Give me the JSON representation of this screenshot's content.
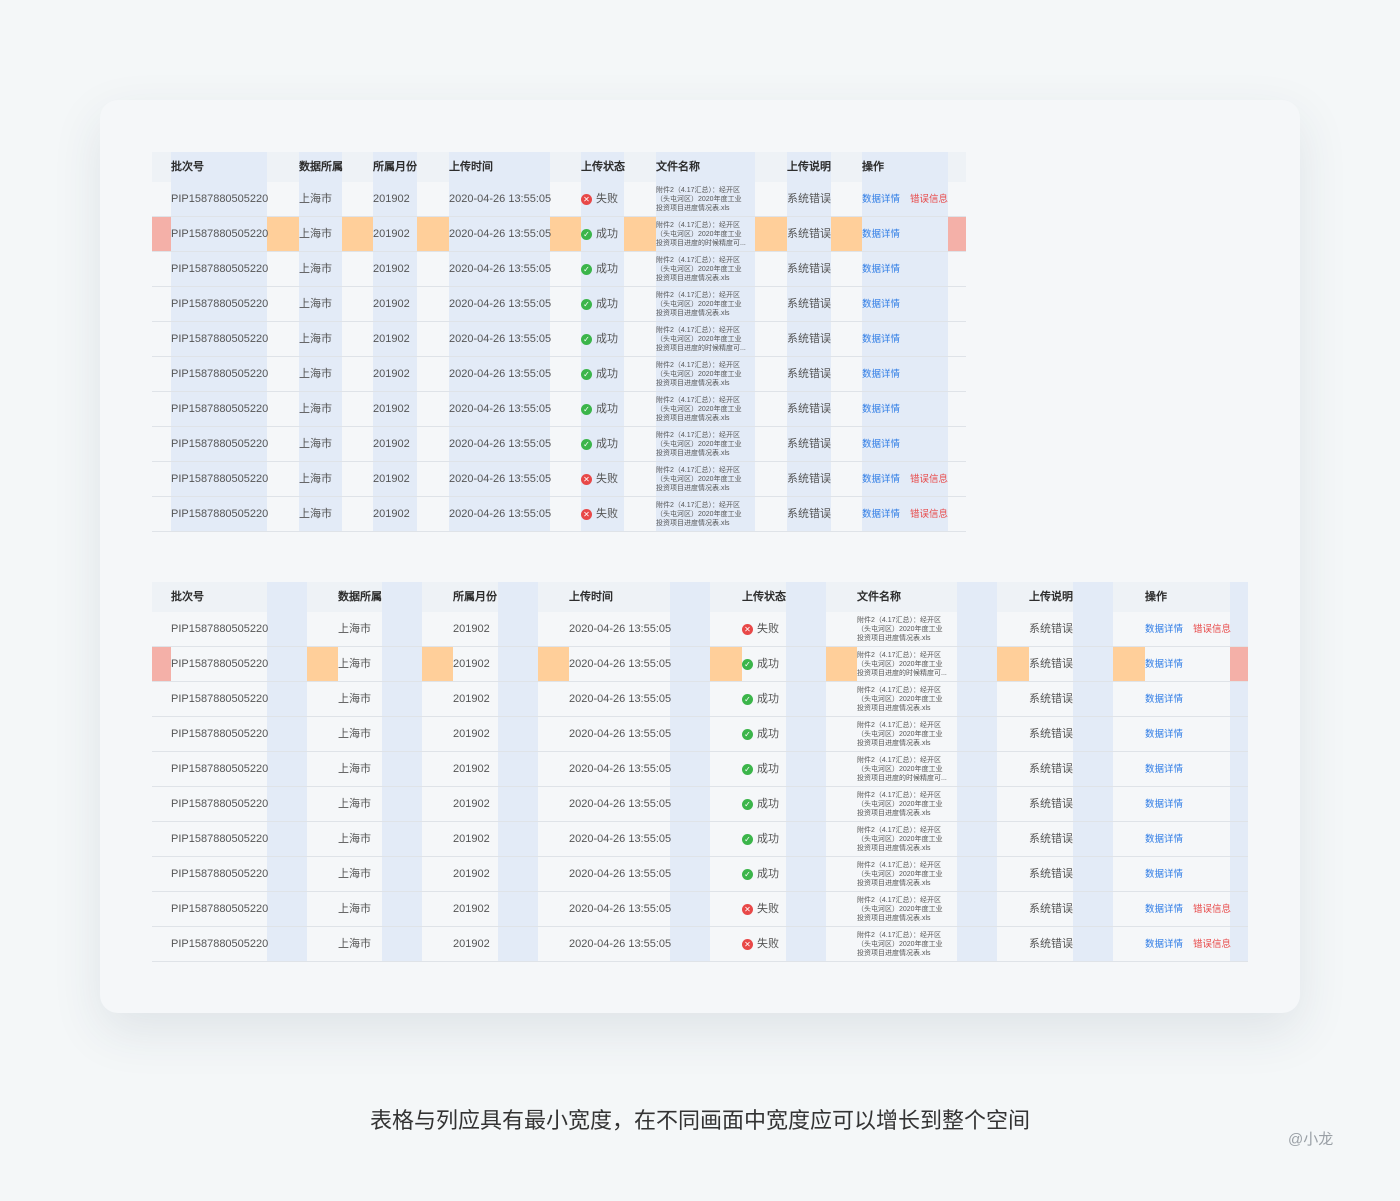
{
  "headers": [
    "批次号",
    "数据所属",
    "所属月份",
    "上传时间",
    "上传状态",
    "文件名称",
    "上传说明",
    "操作"
  ],
  "rows": [
    {
      "batch": "PIP1587880505220",
      "owner": "上海市",
      "month": "201902",
      "time": "2020-04-26 13:55:05",
      "ok": false,
      "status": "失败",
      "file": [
        "附件2（4.17汇总）：经开区",
        "（头屯河区）2020年度工业",
        "投资项目进度情况表.xls"
      ],
      "note": "系统错误",
      "detail": "数据详情",
      "error": "错误信息"
    },
    {
      "batch": "PIP1587880505220",
      "owner": "上海市",
      "month": "201902",
      "time": "2020-04-26 13:55:05",
      "ok": true,
      "status": "成功",
      "file": [
        "附件2（4.17汇总）：经开区",
        "（头屯河区）2020年度工业",
        "投资项目进度的时候精度可..."
      ],
      "note": "系统错误",
      "detail": "数据详情",
      "error": ""
    },
    {
      "batch": "PIP1587880505220",
      "owner": "上海市",
      "month": "201902",
      "time": "2020-04-26 13:55:05",
      "ok": true,
      "status": "成功",
      "file": [
        "附件2（4.17汇总）：经开区",
        "（头屯河区）2020年度工业",
        "投资项目进度情况表.xls"
      ],
      "note": "系统错误",
      "detail": "数据详情",
      "error": ""
    },
    {
      "batch": "PIP1587880505220",
      "owner": "上海市",
      "month": "201902",
      "time": "2020-04-26 13:55:05",
      "ok": true,
      "status": "成功",
      "file": [
        "附件2（4.17汇总）：经开区",
        "（头屯河区）2020年度工业",
        "投资项目进度情况表.xls"
      ],
      "note": "系统错误",
      "detail": "数据详情",
      "error": ""
    },
    {
      "batch": "PIP1587880505220",
      "owner": "上海市",
      "month": "201902",
      "time": "2020-04-26 13:55:05",
      "ok": true,
      "status": "成功",
      "file": [
        "附件2（4.17汇总）：经开区",
        "（头屯河区）2020年度工业",
        "投资项目进度的时候精度可..."
      ],
      "note": "系统错误",
      "detail": "数据详情",
      "error": ""
    },
    {
      "batch": "PIP1587880505220",
      "owner": "上海市",
      "month": "201902",
      "time": "2020-04-26 13:55:05",
      "ok": true,
      "status": "成功",
      "file": [
        "附件2（4.17汇总）：经开区",
        "（头屯河区）2020年度工业",
        "投资项目进度情况表.xls"
      ],
      "note": "系统错误",
      "detail": "数据详情",
      "error": ""
    },
    {
      "batch": "PIP1587880505220",
      "owner": "上海市",
      "month": "201902",
      "time": "2020-04-26 13:55:05",
      "ok": true,
      "status": "成功",
      "file": [
        "附件2（4.17汇总）：经开区",
        "（头屯河区）2020年度工业",
        "投资项目进度情况表.xls"
      ],
      "note": "系统错误",
      "detail": "数据详情",
      "error": ""
    },
    {
      "batch": "PIP1587880505220",
      "owner": "上海市",
      "month": "201902",
      "time": "2020-04-26 13:55:05",
      "ok": true,
      "status": "成功",
      "file": [
        "附件2（4.17汇总）：经开区",
        "（头屯河区）2020年度工业",
        "投资项目进度情况表.xls"
      ],
      "note": "系统错误",
      "detail": "数据详情",
      "error": ""
    },
    {
      "batch": "PIP1587880505220",
      "owner": "上海市",
      "month": "201902",
      "time": "2020-04-26 13:55:05",
      "ok": false,
      "status": "失败",
      "file": [
        "附件2（4.17汇总）：经开区",
        "（头屯河区）2020年度工业",
        "投资项目进度情况表.xls"
      ],
      "note": "系统错误",
      "detail": "数据详情",
      "error": "错误信息"
    },
    {
      "batch": "PIP1587880505220",
      "owner": "上海市",
      "month": "201902",
      "time": "2020-04-26 13:55:05",
      "ok": false,
      "status": "失败",
      "file": [
        "附件2（4.17汇总）：经开区",
        "（头屯河区）2020年度工业",
        "投资项目进度情况表.xls"
      ],
      "note": "系统错误",
      "detail": "数据详情",
      "error": "错误信息"
    }
  ],
  "highlighted_row": 2,
  "caption": "表格与列应具有最小宽度，在不同画面中宽度应可以增长到整个空间",
  "signature": "@小龙",
  "colors": {
    "band": "#e3ebf7",
    "peach": "#ffcf9a",
    "pink": "#f4b0a8",
    "success": "#3bb54a",
    "fail": "#e84848",
    "link": "#2e7ce6"
  }
}
